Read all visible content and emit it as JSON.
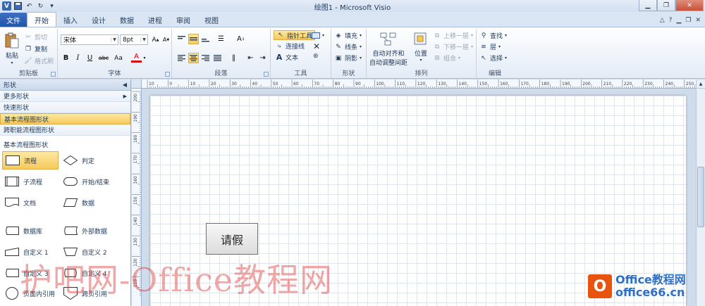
{
  "window": {
    "title": "绘图1 - Microsoft Visio",
    "app_icon": "V"
  },
  "tabs": {
    "file": "文件",
    "items": [
      {
        "label": "开始",
        "active": true
      },
      {
        "label": "插入",
        "active": false
      },
      {
        "label": "设计",
        "active": false
      },
      {
        "label": "数据",
        "active": false
      },
      {
        "label": "进程",
        "active": false
      },
      {
        "label": "审阅",
        "active": false
      },
      {
        "label": "视图",
        "active": false
      }
    ]
  },
  "ribbon": {
    "clipboard": {
      "label": "剪贴板",
      "paste": "粘贴",
      "cut": "剪切",
      "copy": "复制",
      "format_painter": "格式刷"
    },
    "font": {
      "label": "字体",
      "name": "宋体",
      "size": "8pt",
      "bold": "B",
      "italic": "I",
      "underline": "U",
      "strike": "abc",
      "case": "Aa",
      "color": "A"
    },
    "paragraph": {
      "label": "段落"
    },
    "tools": {
      "label": "工具",
      "pointer": "指针工具",
      "connector": "连接线",
      "text": "文本"
    },
    "shape": {
      "label": "形状",
      "fill": "填充",
      "line": "线条",
      "shadow": "阴影"
    },
    "arrange": {
      "label": "排列",
      "auto_align": "自动对齐和",
      "auto_align2": "自动调整间距",
      "position": "位置",
      "bring_forward": "上移一层",
      "send_backward": "下移一层",
      "group": "组合"
    },
    "editing": {
      "label": "编辑",
      "find": "查找",
      "layers": "层",
      "select": "选择"
    }
  },
  "shapes_pane": {
    "header": "形状",
    "stencils": [
      {
        "label": "更多形状",
        "active": false
      },
      {
        "label": "快速形状",
        "active": false
      },
      {
        "label": "基本流程图形状",
        "active": true
      },
      {
        "label": "跨职能流程图形状",
        "active": false
      }
    ],
    "section_title": "基本流程图形状",
    "shapes": [
      {
        "label": "流程",
        "icon": "process-icon"
      },
      {
        "label": "判定",
        "icon": "decision-icon"
      },
      {
        "label": "子流程",
        "icon": "subprocess-icon"
      },
      {
        "label": "开始/结束",
        "icon": "terminator-icon"
      },
      {
        "label": "文档",
        "icon": "document-icon"
      },
      {
        "label": "数据",
        "icon": "data-icon"
      },
      {
        "label": "数据库",
        "icon": "database-icon"
      },
      {
        "label": "外部数据",
        "icon": "external-data-icon"
      },
      {
        "label": "自定义 1",
        "icon": "custom1-icon"
      },
      {
        "label": "自定义 2",
        "icon": "custom2-icon"
      },
      {
        "label": "自定义 3",
        "icon": "custom3-icon"
      },
      {
        "label": "自定义 4",
        "icon": "custom4-icon"
      },
      {
        "label": "页面内引用",
        "icon": "on-page-ref-icon"
      },
      {
        "label": "跨页引用",
        "icon": "off-page-ref-icon"
      }
    ]
  },
  "ruler": {
    "h_ticks": [
      "10",
      "0",
      "10",
      "20",
      "30",
      "40",
      "50",
      "60",
      "70",
      "80",
      "90",
      "100",
      "110",
      "120",
      "130",
      "140",
      "150",
      "160",
      "170",
      "180",
      "190",
      "200",
      "210",
      "220",
      "230",
      "240",
      "250",
      "260",
      "270",
      "280",
      "290"
    ],
    "v_ticks": [
      "200",
      "190",
      "180",
      "170",
      "160",
      "150",
      "140",
      "130",
      "120",
      "110"
    ]
  },
  "canvas": {
    "shape_text": "请假"
  },
  "watermark": {
    "text": "护吧网-Office教程网",
    "logo_line1": "Office教程网",
    "logo_line2": "office66.cn"
  },
  "colors": {
    "accent": "#1f56ac",
    "highlight": "#f7c95a",
    "watermark": "#e8540e"
  }
}
